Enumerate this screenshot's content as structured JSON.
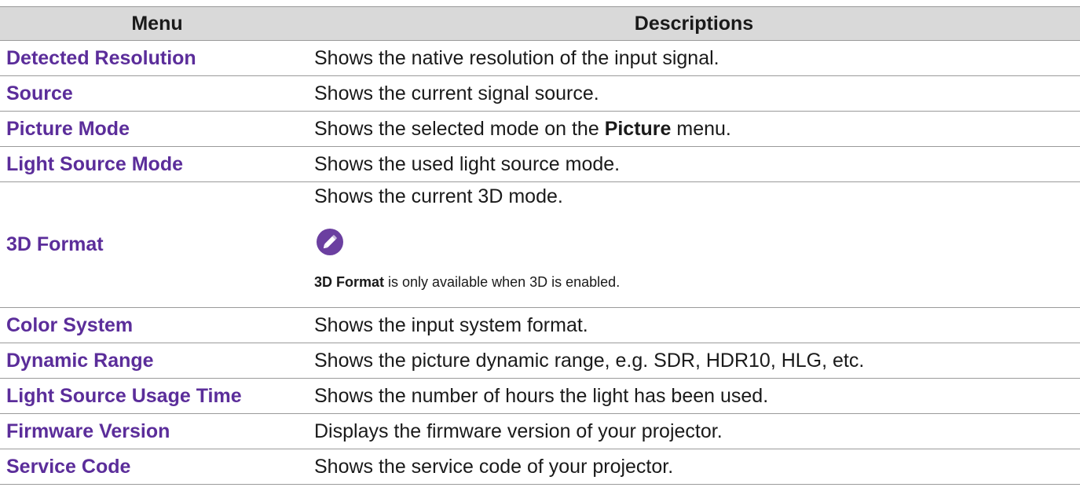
{
  "header": {
    "menu": "Menu",
    "descriptions": "Descriptions"
  },
  "rows": [
    {
      "menu": "Detected Resolution",
      "desc": "Shows the native resolution of the input signal."
    },
    {
      "menu": "Source",
      "desc": "Shows the current signal source."
    },
    {
      "menu": "Picture Mode",
      "desc_before": "Shows the selected mode on the ",
      "desc_bold": "Picture",
      "desc_after": " menu."
    },
    {
      "menu": "Light Source Mode",
      "desc": "Shows the used light source mode."
    },
    {
      "menu": "3D Format",
      "desc": "Shows the current 3D mode.",
      "note_bold": "3D Format",
      "note_rest": " is only available when 3D is enabled.",
      "note_icon": "pencil-note-icon"
    },
    {
      "menu": "Color System",
      "desc": "Shows the input system format."
    },
    {
      "menu": "Dynamic Range",
      "desc": "Shows the picture dynamic range, e.g. SDR, HDR10, HLG, etc."
    },
    {
      "menu": "Light Source Usage Time",
      "desc": "Shows the number of hours the light has been used."
    },
    {
      "menu": "Firmware Version",
      "desc": "Displays the firmware version of your projector."
    },
    {
      "menu": "Service Code",
      "desc": "Shows the service code of your projector."
    }
  ],
  "colors": {
    "menu_label": "#5b2d9a",
    "header_bg": "#d9d9d9",
    "icon_bg": "#6b3fa0"
  }
}
